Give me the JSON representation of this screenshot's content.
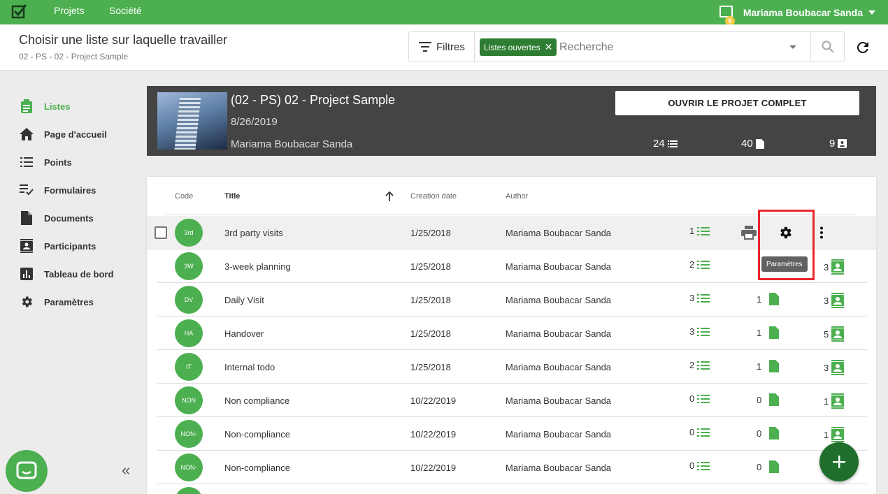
{
  "topbar": {
    "nav": [
      "Projets",
      "Société"
    ],
    "notification_count": "9",
    "user_name": "Mariama Boubacar Sanda"
  },
  "header": {
    "title": "Choisir une liste sur laquelle travailler",
    "breadcrumb": "02 - PS - 02 - Project Sample",
    "filters_label": "Filtres",
    "active_filter_chip": "Listes ouvertes",
    "search_placeholder": "Recherche"
  },
  "sidebar": {
    "items": [
      {
        "label": "Listes",
        "icon": "clipboard-list-icon",
        "active": true
      },
      {
        "label": "Page d'accueil",
        "icon": "home-icon",
        "active": false
      },
      {
        "label": "Points",
        "icon": "list-icon",
        "active": false
      },
      {
        "label": "Formulaires",
        "icon": "checklist-icon",
        "active": false
      },
      {
        "label": "Documents",
        "icon": "document-icon",
        "active": false
      },
      {
        "label": "Participants",
        "icon": "contact-card-icon",
        "active": false
      },
      {
        "label": "Tableau de bord",
        "icon": "bar-chart-icon",
        "active": false
      },
      {
        "label": "Paramètres",
        "icon": "gear-icon",
        "active": false
      }
    ],
    "collapse_label": "«"
  },
  "project": {
    "name": "(02 - PS) 02 - Project Sample",
    "date": "8/26/2019",
    "author": "Mariama Boubacar Sanda",
    "open_button": "OUVRIR LE PROJET COMPLET",
    "stats": {
      "lists": "24",
      "documents": "40",
      "participants": "9"
    }
  },
  "table": {
    "columns": {
      "code": "Code",
      "title": "Title",
      "creation_date": "Creation date",
      "author": "Author"
    },
    "rows": [
      {
        "code": "3rd",
        "title": "3rd party visits",
        "date": "1/25/2018",
        "author": "Mariama Boubacar Sanda",
        "points": "1",
        "documents": "",
        "participants": ""
      },
      {
        "code": "3W",
        "title": "3-week planning",
        "date": "1/25/2018",
        "author": "Mariama Boubacar Sanda",
        "points": "2",
        "documents": "",
        "participants": "3"
      },
      {
        "code": "DV",
        "title": "Daily Visit",
        "date": "1/25/2018",
        "author": "Mariama Boubacar Sanda",
        "points": "3",
        "documents": "1",
        "participants": "3"
      },
      {
        "code": "HA",
        "title": "Handover",
        "date": "1/25/2018",
        "author": "Mariama Boubacar Sanda",
        "points": "3",
        "documents": "1",
        "participants": "5"
      },
      {
        "code": "IT",
        "title": "Internal todo",
        "date": "1/25/2018",
        "author": "Mariama Boubacar Sanda",
        "points": "2",
        "documents": "1",
        "participants": "3"
      },
      {
        "code": "NON",
        "title": "Non compliance",
        "date": "10/22/2019",
        "author": "Mariama Boubacar Sanda",
        "points": "0",
        "documents": "0",
        "participants": "1"
      },
      {
        "code": "NON-",
        "title": "Non-compliance",
        "date": "10/22/2019",
        "author": "Mariama Boubacar Sanda",
        "points": "0",
        "documents": "0",
        "participants": "1"
      },
      {
        "code": "NON-",
        "title": "Non-compliance",
        "date": "10/22/2019",
        "author": "Mariama Boubacar Sanda",
        "points": "0",
        "documents": "0",
        "participants": ""
      }
    ],
    "tooltip": "Paramètres"
  },
  "colors": {
    "brand_green": "#4caf50",
    "dark_green": "#1f6e2c",
    "highlight_red": "#e8272b"
  }
}
